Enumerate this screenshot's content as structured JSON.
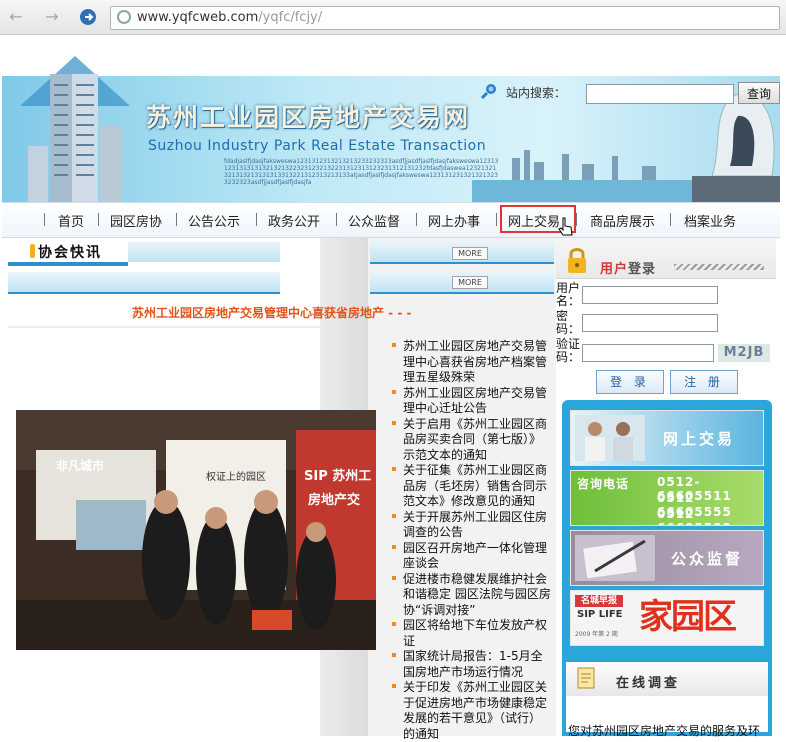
{
  "browser": {
    "address_host": "www.yqfcweb.com",
    "address_path": "/yqfc/fcjy/"
  },
  "header": {
    "title_cn": "苏州工业园区房地产交易网",
    "title_en": "Suzhou Industry Park Real Estate Transaction",
    "ticker_text": "fdadjaslfjdasjfaksweswa1231312313213213233232323asdfjjasdfjaslfjdasjfaksweswa1231312313131313213213223231232132231312313123231312131232fdasfjdaswea12321321321313213131313313221312313213133atjasdfjaslfjdasjfaksweswa1231312313213213233232323asdfjjasdfjaslfjdasjfa",
    "search_label": "站内搜索：",
    "search_placeholder": "",
    "search_button": "查询"
  },
  "nav": {
    "items": [
      {
        "label": "首页"
      },
      {
        "label": "园区房协"
      },
      {
        "label": "公告公示"
      },
      {
        "label": "政务公开"
      },
      {
        "label": "公众监督"
      },
      {
        "label": "网上办事"
      },
      {
        "label": "网上交易"
      },
      {
        "label": "商品房展示"
      },
      {
        "label": "档案业务"
      }
    ],
    "active": "网上交易"
  },
  "association": {
    "title": "协会快讯",
    "more_label": "MORE",
    "headline": "苏州工业园区房地产交易管理中心喜获省房地产 - - -",
    "photo_sign_1": "非凡城市",
    "photo_sign_2": "权证上的园区",
    "photo_sign_3": "SIP 苏州工",
    "photo_sign_4": "房地产交"
  },
  "news": {
    "items": [
      "苏州工业园区房地产交易管理中心喜获省房地产档案管理五星级殊荣",
      "苏州工业园区房地产交易管理中心迁址公告",
      "关于启用《苏州工业园区商品房买卖合同（第七版）》示范文本的通知",
      "关于征集《苏州工业园区商品房（毛坯房）销售合同示范文本》修改意见的通知",
      "关于开展苏州工业园区住房调查的公告",
      "园区召开房地产一体化管理座谈会",
      "促进楼市稳健发展维护社会和谐稳定 园区法院与园区房协“诉调对接”",
      "园区将给地下车位发放产权证",
      "国家统计局报告：1-5月全国房地产市场运行情况",
      "关于印发《苏州工业园区关于促进房地产市场健康稳定发展的若干意见》（试行）的通知"
    ]
  },
  "login": {
    "title_prefix": "用户",
    "title_suffix": "登录",
    "username_label": "用户名：",
    "password_label": "密　码：",
    "captcha_label": "验证码：",
    "captcha_text": "M2JB",
    "login_button": "登 录",
    "register_button": "注 册"
  },
  "ads": {
    "online_trade": "网上交易",
    "hotline_label": "咨询电话",
    "phones": [
      "0512-66605511",
      "0512-66605555",
      "0512-66605533"
    ],
    "supervision": "公众监督",
    "magazine_badge": "名城早报",
    "magazine_sub": "SIP LIFE",
    "magazine_title": "家园区",
    "magazine_issue": "2009 年第 2 期"
  },
  "survey": {
    "title": "在线调查",
    "question": "您对苏州园区房地产交易的服务及环"
  },
  "colors": {
    "brand_blue": "#2aa6da",
    "headline_orange": "#e0541b",
    "active_border": "#e23434",
    "login_red": "#d43636"
  }
}
